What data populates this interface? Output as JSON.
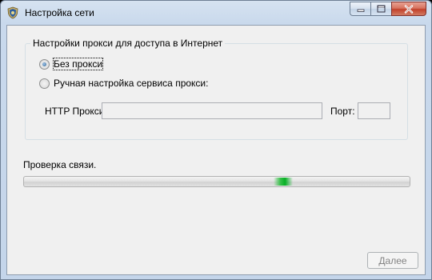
{
  "window": {
    "title": "Настройка сети",
    "controls": [
      "minimize-icon",
      "maximize-icon",
      "close-icon"
    ]
  },
  "proxy_group": {
    "title": "Настройки прокси для доступа в Интернет",
    "options": [
      {
        "label": "Без прокси",
        "checked": true,
        "focused": true
      },
      {
        "label": "Ручная настройка сервиса прокси:",
        "checked": false,
        "focused": false
      }
    ],
    "http_label": "HTTP Прокси:",
    "http_value": "",
    "port_label": "Порт:",
    "port_value": ""
  },
  "connection": {
    "status_label": "Проверка связи.",
    "progress_type": "marquee",
    "accent_color": "#06b025"
  },
  "footer": {
    "next_label": "Далее",
    "next_enabled": false
  }
}
